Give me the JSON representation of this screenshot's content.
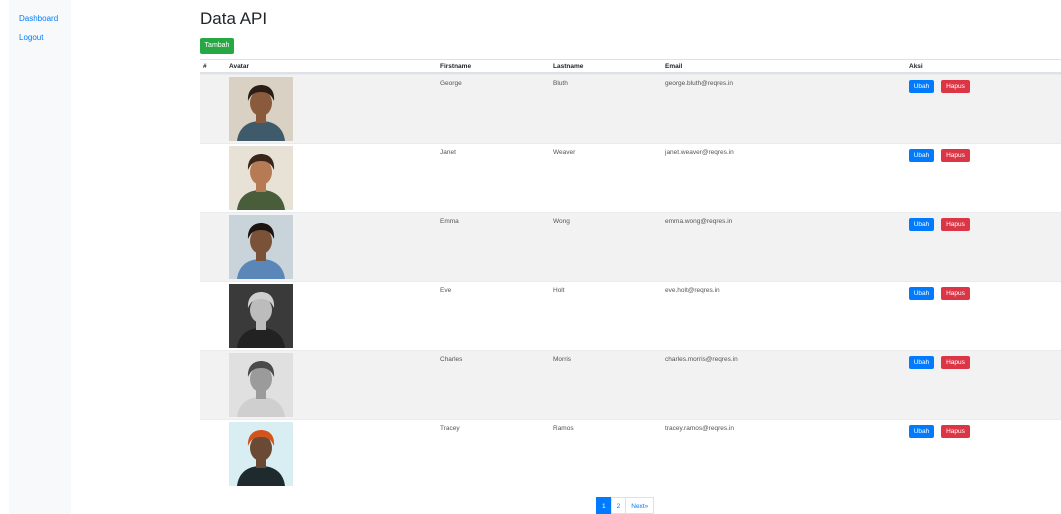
{
  "sidebar": {
    "items": [
      {
        "label": "Dashboard"
      },
      {
        "label": "Logout"
      }
    ]
  },
  "page": {
    "title": "Data API",
    "add_label": "Tambah"
  },
  "table": {
    "headers": {
      "no": "#",
      "avatar": "Avatar",
      "firstname": "Firstname",
      "lastname": "Lastname",
      "email": "Email",
      "actions": "Aksi"
    },
    "edit_label": "Ubah",
    "delete_label": "Hapus",
    "rows": [
      {
        "firstname": "George",
        "lastname": "Bluth",
        "email": "george.bluth@reqres.in"
      },
      {
        "firstname": "Janet",
        "lastname": "Weaver",
        "email": "janet.weaver@reqres.in"
      },
      {
        "firstname": "Emma",
        "lastname": "Wong",
        "email": "emma.wong@reqres.in"
      },
      {
        "firstname": "Eve",
        "lastname": "Holt",
        "email": "eve.holt@reqres.in"
      },
      {
        "firstname": "Charles",
        "lastname": "Morris",
        "email": "charles.morris@reqres.in"
      },
      {
        "firstname": "Tracey",
        "lastname": "Ramos",
        "email": "tracey.ramos@reqres.in"
      }
    ]
  },
  "pagination": {
    "pages": [
      "1",
      "2"
    ],
    "next_label": "Next»",
    "active_page": "1"
  },
  "colors": {
    "primary": "#007bff",
    "success": "#28a745",
    "danger": "#dc3545",
    "stripe": "#f2f2f2"
  }
}
